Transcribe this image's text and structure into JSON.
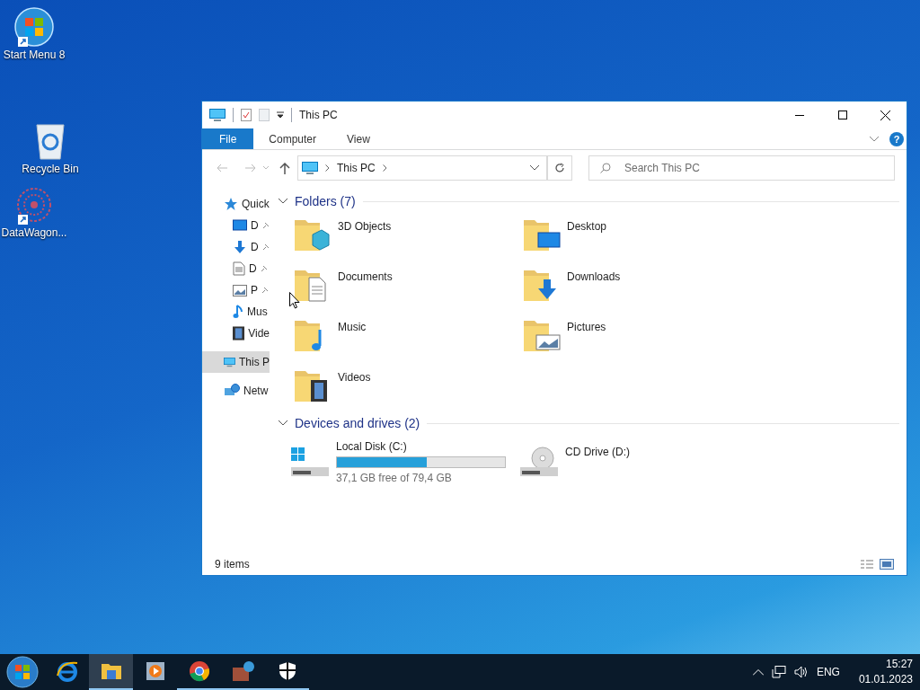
{
  "desktop_icons": [
    {
      "label": "Start Menu 8",
      "kind": "orb",
      "shortcut": true
    },
    {
      "label": "Recycle Bin",
      "kind": "bin",
      "shortcut": false
    },
    {
      "label": "DataWagon...",
      "kind": "web",
      "shortcut": true
    }
  ],
  "window": {
    "title": "This PC",
    "ribbon_tabs": [
      {
        "label": "File",
        "selected": true
      },
      {
        "label": "Computer",
        "selected": false
      },
      {
        "label": "View",
        "selected": false
      }
    ],
    "help": "?",
    "address": "This PC",
    "search": {
      "placeholder": "Search This PC"
    },
    "nav": [
      {
        "label": "Quick",
        "kind": "star",
        "pinned": false,
        "selected": false
      },
      {
        "label": "D",
        "kind": "desktop",
        "pinned": true,
        "selected": false
      },
      {
        "label": "D",
        "kind": "download",
        "pinned": true,
        "selected": false
      },
      {
        "label": "D",
        "kind": "document",
        "pinned": true,
        "selected": false
      },
      {
        "label": "P",
        "kind": "picture",
        "pinned": true,
        "selected": false
      },
      {
        "label": "Mus",
        "kind": "music",
        "pinned": false,
        "selected": false
      },
      {
        "label": "Vide",
        "kind": "video",
        "pinned": false,
        "selected": false
      },
      {
        "label": "This P",
        "kind": "pc",
        "pinned": false,
        "selected": true
      },
      {
        "label": "Netw",
        "kind": "network",
        "pinned": false,
        "selected": false
      }
    ],
    "folders_header": "Folders (7)",
    "folders": [
      {
        "label": "3D Objects",
        "kind": "cube"
      },
      {
        "label": "Desktop",
        "kind": "desktop"
      },
      {
        "label": "Documents",
        "kind": "document"
      },
      {
        "label": "Downloads",
        "kind": "download"
      },
      {
        "label": "Music",
        "kind": "music"
      },
      {
        "label": "Pictures",
        "kind": "picture"
      },
      {
        "label": "Videos",
        "kind": "video"
      }
    ],
    "drives_header": "Devices and drives (2)",
    "drives": [
      {
        "label": "Local Disk (C:)",
        "kind": "disk",
        "level": 0.533,
        "free": "37,1 GB free of 79,4 GB"
      },
      {
        "label": "CD Drive (D:)",
        "kind": "cd"
      }
    ],
    "status": "9 items"
  },
  "taskbar": {
    "apps": [
      {
        "kind": "ie",
        "selected": false,
        "running": false
      },
      {
        "kind": "explorer",
        "selected": true,
        "running": true
      },
      {
        "kind": "media",
        "selected": false,
        "running": false
      },
      {
        "kind": "chrome",
        "selected": false,
        "running": true
      },
      {
        "kind": "archive",
        "selected": false,
        "running": true
      },
      {
        "kind": "shield",
        "selected": false,
        "running": true
      }
    ],
    "language": "ENG",
    "time": "15:27",
    "date": "01.01.2023"
  }
}
